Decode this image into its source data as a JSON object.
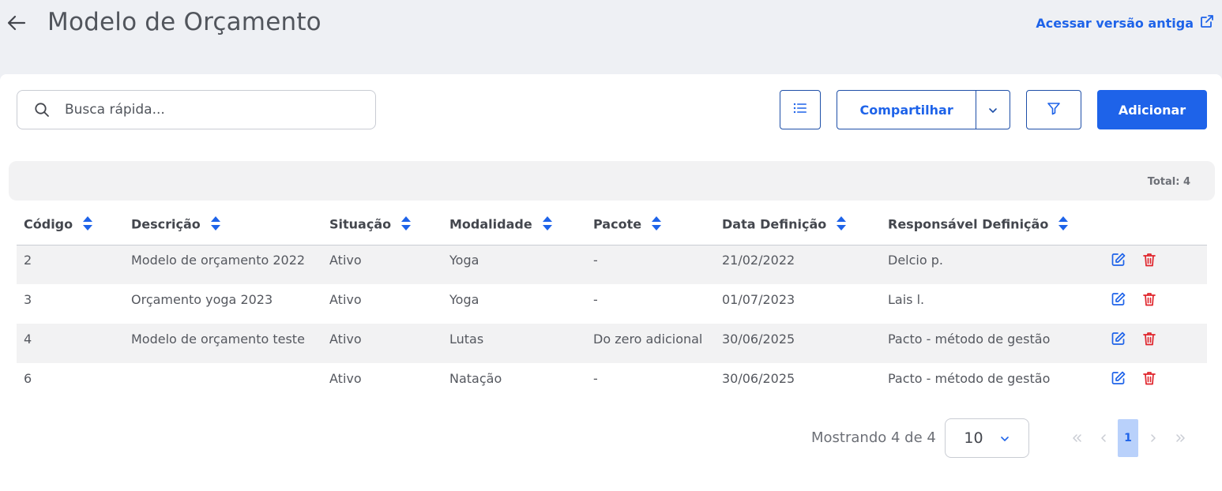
{
  "header": {
    "title": "Modelo de Orçamento",
    "old_version_link": "Acessar versão antiga"
  },
  "toolbar": {
    "search_placeholder": "Busca rápida...",
    "share_label": "Compartilhar",
    "add_label": "Adicionar"
  },
  "summary": {
    "total": "Total: 4"
  },
  "table": {
    "columns": [
      "Código",
      "Descrição",
      "Situação",
      "Modalidade",
      "Pacote",
      "Data Definição",
      "Responsável Definição"
    ],
    "rows": [
      [
        "2",
        "Modelo de orçamento 2022",
        "Ativo",
        "Yoga",
        "-",
        "21/02/2022",
        "Delcio p."
      ],
      [
        "3",
        "Orçamento yoga 2023",
        "Ativo",
        "Yoga",
        "-",
        "01/07/2023",
        "Lais l."
      ],
      [
        "4",
        "Modelo de orçamento teste",
        "Ativo",
        "Lutas",
        "Do zero adicional",
        "30/06/2025",
        "Pacto - método de gestão"
      ],
      [
        "6",
        "",
        "Ativo",
        "Natação",
        "-",
        "30/06/2025",
        "Pacto - método de gestão"
      ]
    ]
  },
  "pagination": {
    "showing": "Mostrando 4 de 4",
    "page_size": "10",
    "current_page": "1"
  },
  "colors": {
    "primary": "#1e63e9",
    "danger": "#e0242b",
    "background": "#eef0f4",
    "stripe": "#f2f2f3"
  }
}
